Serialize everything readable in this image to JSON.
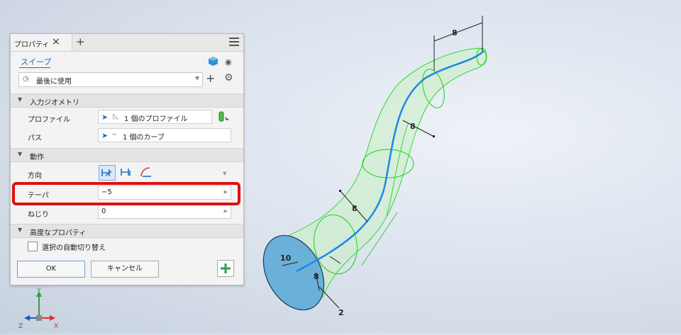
{
  "panel": {
    "tab_label": "プロパティ",
    "title_link": "スイープ",
    "preset_value": "最後に使用",
    "sections": {
      "input_geometry": "入力ジオメトリ",
      "behavior": "動作",
      "advanced": "高度なプロパティ"
    },
    "rows": {
      "profile_label": "プロファイル",
      "profile_value": "1 個のプロファイル",
      "path_label": "パス",
      "path_value": "1 個のカーブ",
      "direction_label": "方向",
      "taper_label": "テーパ",
      "taper_value": "−5",
      "twist_label": "ねじり",
      "twist_value": "0"
    },
    "auto_switch_label": "選択の自動切り替え",
    "ok_label": "OK",
    "cancel_label": "キャンセル"
  },
  "viewport": {
    "dimensions": [
      "8",
      "8",
      "8",
      "10",
      "8",
      "2"
    ]
  },
  "triad": {
    "x": "X",
    "y": "Y",
    "z": "Z"
  },
  "colors": {
    "link": "#1f6fc5",
    "highlight": "#e01010",
    "sweep_fill": "#c9f0c2",
    "sweep_edge": "#33d633",
    "path": "#1e88e5",
    "profile_face": "#6ab0d8"
  }
}
